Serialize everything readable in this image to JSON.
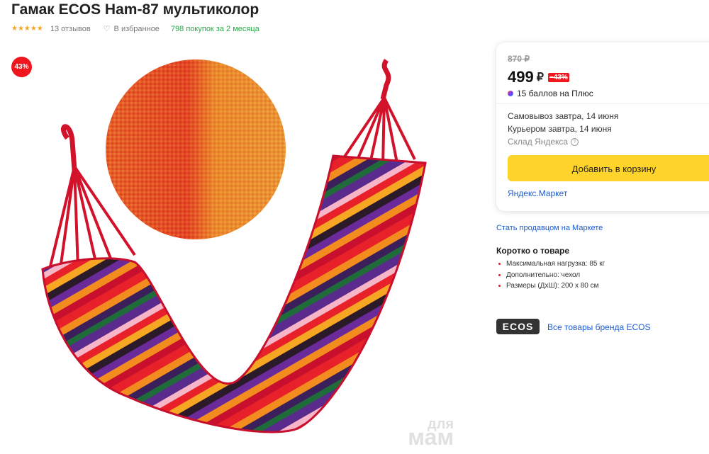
{
  "product": {
    "title": "Гамак ECOS Ham-87 мультиколор",
    "stars": "★★★★★",
    "reviews": "13 отзывов",
    "favorite_label": "В избранное",
    "bought": "798 покупок за 2 месяца",
    "discount_badge": "43%",
    "rating": 4.5
  },
  "offer": {
    "old_price": "870 ₽",
    "price": "499",
    "currency": "₽",
    "discount": "−43%",
    "plus_points": "15 баллов на Плюс",
    "pickup": "Самовывоз завтра, 14 июня",
    "courier": "Курьером завтра, 14 июня",
    "warehouse": "Склад Яндекса",
    "add_to_cart": "Добавить в корзину",
    "seller": "Яндекс.Маркет"
  },
  "seller_link": "Стать продавцом на Маркете",
  "brief": {
    "title": "Коротко о товаре",
    "items": [
      "Максимальная нагрузка: 85 кг",
      "Дополнительно: чехол",
      "Размеры (ДхШ): 200 х 80 см"
    ]
  },
  "brand": {
    "logo": "ECOS",
    "link": "Все товары бренда ECOS"
  },
  "watermark": {
    "line1": "для",
    "line2": "мам"
  },
  "colors": {
    "accent_yellow": "#fed42b",
    "discount_red": "#f0161e",
    "link_blue": "#1a5bd6",
    "bought_green": "#2aa84a"
  }
}
